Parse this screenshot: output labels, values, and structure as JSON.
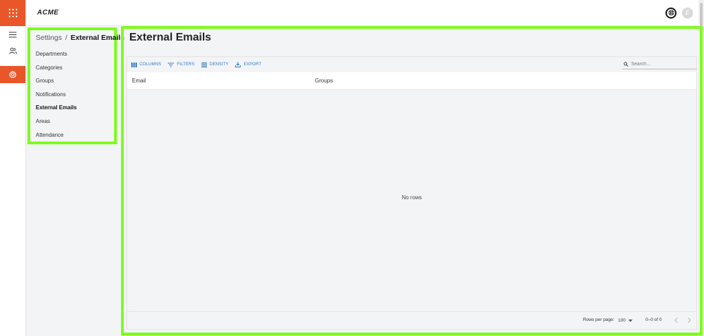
{
  "app": {
    "logo": "ACME",
    "avatar_initial": "F"
  },
  "breadcrumb": {
    "root": "Settings",
    "separator": "/",
    "current": "External Emails"
  },
  "settings_nav": [
    {
      "label": "Departments"
    },
    {
      "label": "Categories"
    },
    {
      "label": "Groups"
    },
    {
      "label": "Notifications"
    },
    {
      "label": "External Emails",
      "active": true
    },
    {
      "label": "Areas"
    },
    {
      "label": "Attendance"
    }
  ],
  "page": {
    "title": "External Emails"
  },
  "toolbar": {
    "columns": "COLUMNS",
    "filters": "FILTERS",
    "density": "DENSITY",
    "export": "EXPORT",
    "search_placeholder": "Search…"
  },
  "table": {
    "columns": [
      "Email",
      "Groups"
    ],
    "empty_text": "No rows"
  },
  "pagination": {
    "rows_per_page_label": "Rows per page:",
    "rows_per_page": "100",
    "range": "0–0 of 0"
  },
  "colors": {
    "brand": "#e8562a",
    "accent_blue": "#2f76c9",
    "highlight": "#7cfc1c"
  },
  "icons": {
    "rail": [
      "apps-grid-icon",
      "menu-icon",
      "users-icon",
      "gear-icon"
    ],
    "top": [
      "help-icon",
      "avatar"
    ]
  }
}
